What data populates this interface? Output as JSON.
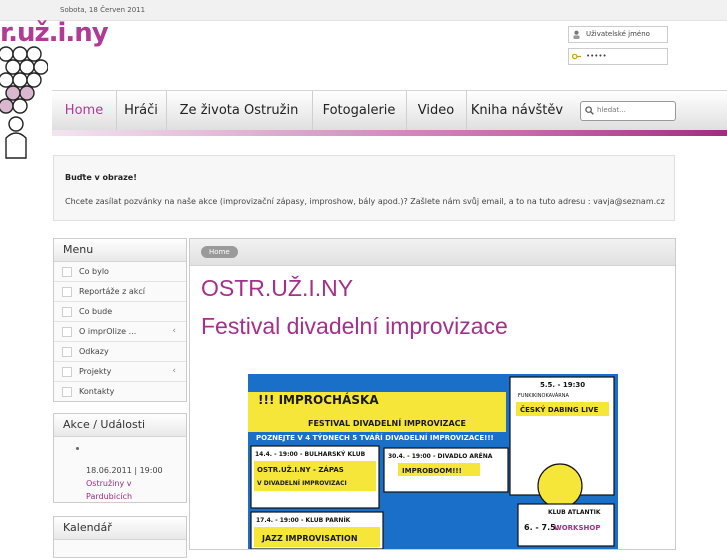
{
  "header": {
    "date": "Sobota, 18 Červen 2011",
    "logo_text": "r.už.i.ny"
  },
  "login": {
    "username_placeholder": "Uživatelské jméno",
    "password_value": "•••••"
  },
  "nav": {
    "items": [
      "Home",
      "Hráči",
      "Ze života Ostružin",
      "Fotogalerie",
      "Video",
      "Kniha návštěv"
    ],
    "search_placeholder": "hledat..."
  },
  "notice": {
    "title": "Buďte v obraze!",
    "text": "Chcete zasílat pozvánky na naše akce (improvizační zápasy, improshow, bály apod.)? Zašlete nám svůj email, a to na tuto adresu : vavja@seznam.cz"
  },
  "menu": {
    "title": "Menu",
    "items": [
      "Co bylo",
      "Reportáže z akcí",
      "Co bude",
      "O imprOlize ...",
      "Odkazy",
      "Projekty",
      "Kontakty"
    ]
  },
  "events": {
    "title": "Akce / Události",
    "date": "18.06.2011 | 19:00",
    "link_line1": "Ostružiny v",
    "link_line2": "Pardubicích"
  },
  "calendar": {
    "title": "Kalendář"
  },
  "main": {
    "breadcrumb": "Home",
    "title": "OSTR.UŽ.I.NY",
    "subtitle": "Festival divadelní improvizace"
  },
  "poster": {
    "title": "!!! IMPROCHÁSKA",
    "subtitle": "FESTIVAL DIVADELNÍ IMPROVIZACE",
    "tagline": "POZNEJTE V 4 TÝDNECH 5 TVÁŘÍ DIVADELNÍ IMPROVIZACE!!!",
    "e1_time": "14.4. - 19:00 - BULHARSKÝ KLUB",
    "e1_name": "OSTR.UŽ.I.NY - ZÁPAS",
    "e1_name2": "V DIVADELNÍ IMPROVIZACI",
    "e2_time": "30.4. - 19:00 - DIVADLO ARÉNA",
    "e2_name": "IMPROBOOM!!!",
    "e3_time": "5.5. - 19:30",
    "e3_place": "FUNKIKINOKAVÁRNA",
    "e3_name": "ČESKÝ DABING LIVE",
    "e4_time": "17.4. - 19:00 - KLUB PARNÍK",
    "e4_name": "JAZZ IMPROVISATION",
    "e5_place": "KLUB ATLANTIK",
    "e5_time": "6. - 7.5.",
    "e5_name": "WORKSHOP"
  },
  "colors": {
    "accent": "#a3308a",
    "poster_yellow": "#f7e63a",
    "poster_blue": "#1a70c9"
  }
}
